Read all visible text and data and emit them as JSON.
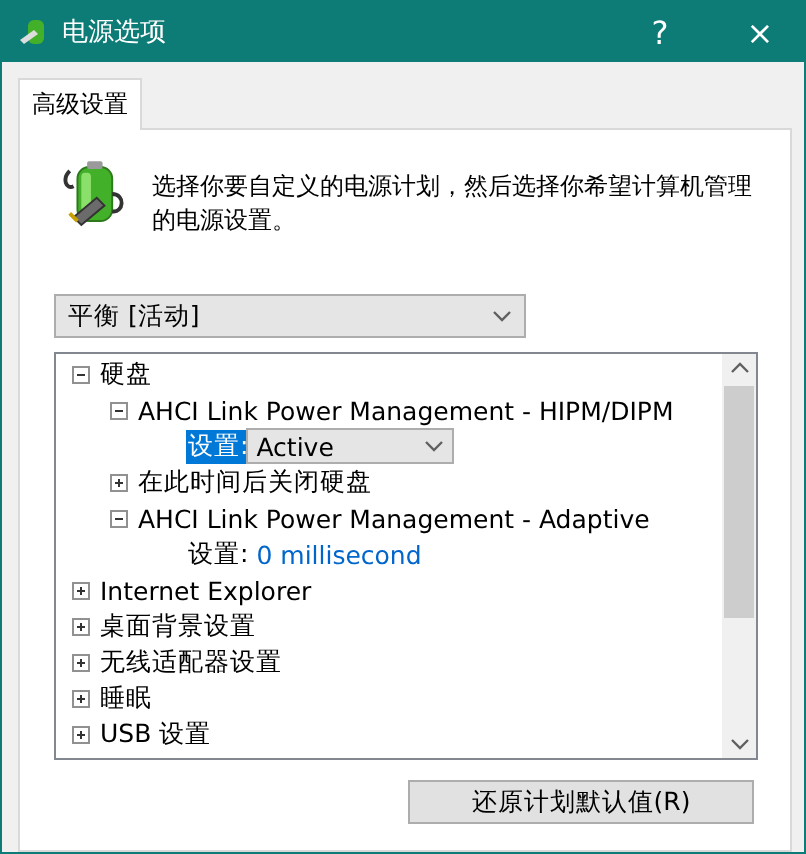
{
  "window": {
    "title": "电源选项",
    "buttons": [
      "?",
      "×"
    ]
  },
  "tabs": [
    {
      "label": "高级设置",
      "selected": true
    }
  ],
  "description": "选择你要自定义的电源计划，然后选择你希望计算机管理的电源设置。",
  "plan_select": {
    "value": "平衡 [活动]"
  },
  "tree": [
    {
      "kind": "node",
      "label": "硬盘",
      "expanded": true,
      "children": [
        {
          "kind": "node",
          "label": "AHCI Link Power Management - HIPM/DIPM",
          "expanded": true,
          "children": [
            {
              "kind": "setting",
              "label": "设置:",
              "value": "Active",
              "selected": true
            }
          ]
        },
        {
          "kind": "node",
          "label": "在此时间后关闭硬盘",
          "expanded": false
        },
        {
          "kind": "node",
          "label": "AHCI Link Power Management - Adaptive",
          "expanded": true,
          "children": [
            {
              "kind": "setting",
              "label": "设置:",
              "value": "0 millisecond",
              "selected": false
            }
          ]
        }
      ]
    },
    {
      "kind": "node",
      "label": "Internet Explorer",
      "expanded": false
    },
    {
      "kind": "node",
      "label": "桌面背景设置",
      "expanded": false
    },
    {
      "kind": "node",
      "label": "无线适配器设置",
      "expanded": false
    },
    {
      "kind": "node",
      "label": "睡眠",
      "expanded": false
    },
    {
      "kind": "node",
      "label": "USB 设置",
      "expanded": false
    }
  ],
  "restore_button": "还原计划默认值(R)"
}
